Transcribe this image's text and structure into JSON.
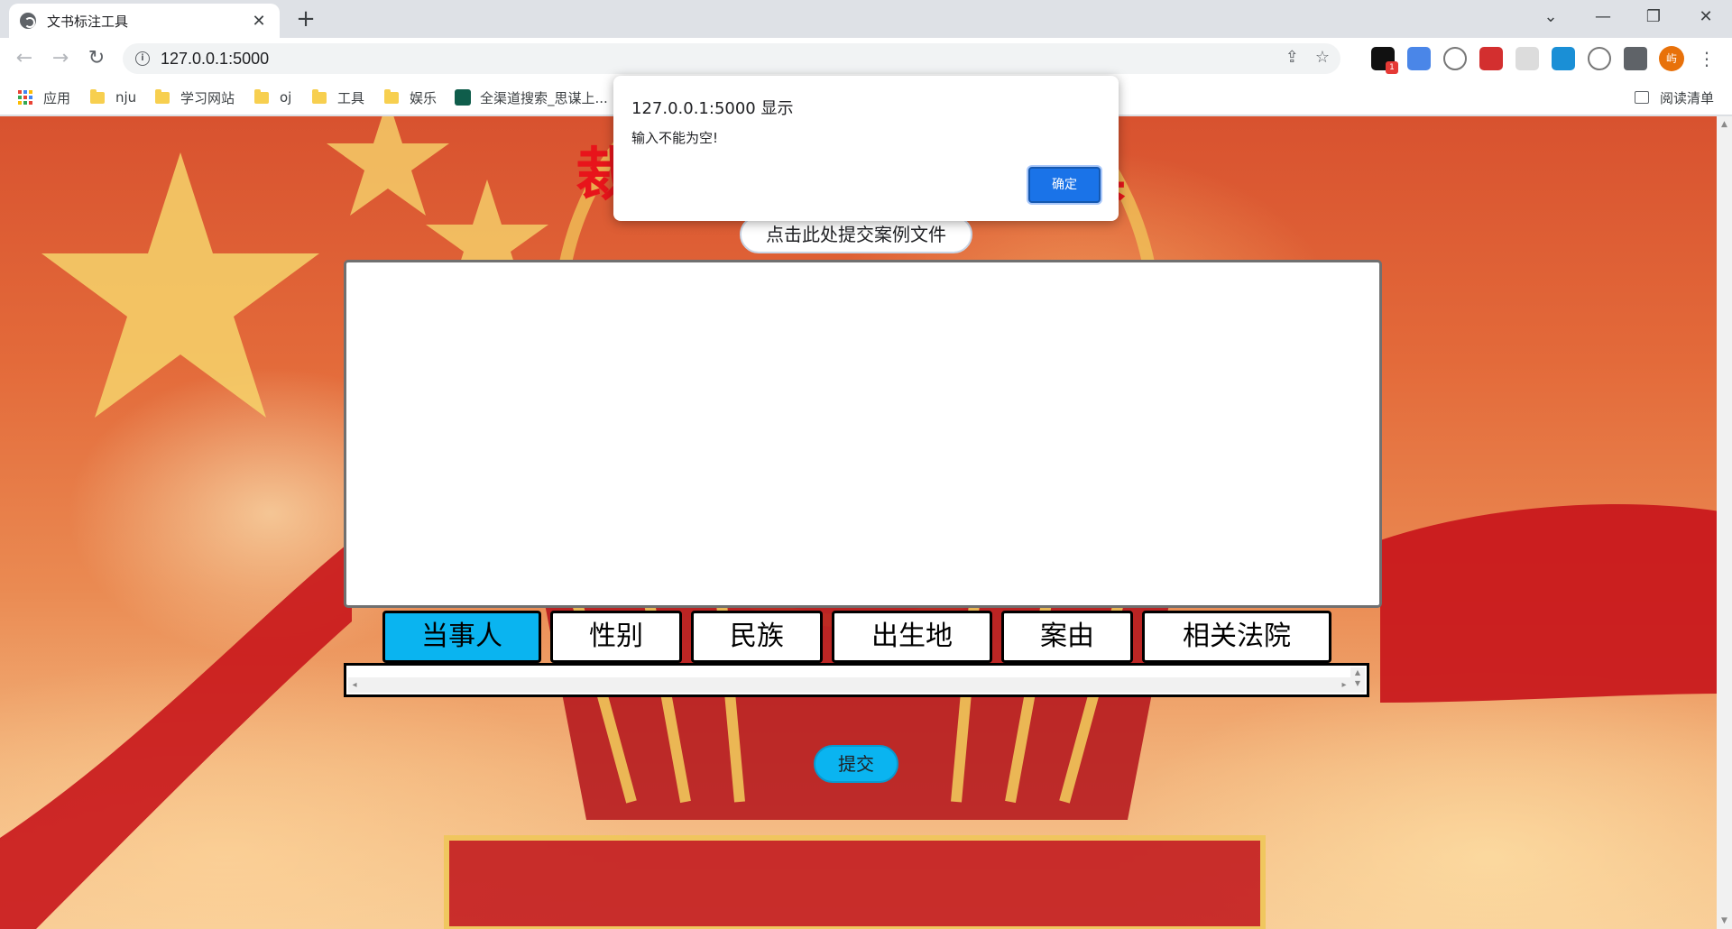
{
  "browser": {
    "tab_title": "文书标注工具",
    "tab_close": "✕",
    "new_tab": "+",
    "window_controls": {
      "tab_search": "⌄",
      "minimize": "—",
      "restore": "❐",
      "close": "✕"
    },
    "nav": {
      "back": "←",
      "forward": "→",
      "reload": "↻"
    },
    "url": "127.0.0.1:5000",
    "omnibox_actions": {
      "share": "⇪",
      "bookmark_star": "☆"
    },
    "extensions": [
      "notification-badge-icon",
      "translate-icon",
      "cloud-icon",
      "pdf-icon",
      "screen-share-icon",
      "folder-blue-icon",
      "cloud-icon-2",
      "puzzle-icon"
    ],
    "avatar_text": "屿",
    "menu": "⋮"
  },
  "bookmarks": {
    "items": [
      {
        "label": "应用",
        "icon": "apps-grid-icon"
      },
      {
        "label": "nju",
        "icon": "folder-icon"
      },
      {
        "label": "学习网站",
        "icon": "folder-icon"
      },
      {
        "label": "oj",
        "icon": "folder-icon"
      },
      {
        "label": "工具",
        "icon": "folder-icon"
      },
      {
        "label": "娱乐",
        "icon": "folder-icon"
      },
      {
        "label": "全渠道搜索_思谋上...",
        "icon": "site-icon"
      }
    ],
    "reading_list": "阅读清单"
  },
  "page": {
    "title": "裁判文书标注工具",
    "upload_button": "点击此处提交案例文件",
    "tags": [
      "当事人",
      "性别",
      "民族",
      "出生地",
      "案由",
      "相关法院"
    ],
    "active_tag": "当事人",
    "submit_button": "提交",
    "colors": {
      "title": "#e8141b",
      "active_tag": "#0ab4f0",
      "submit": "#0ab4f0"
    }
  },
  "dialog": {
    "title": "127.0.0.1:5000 显示",
    "message": "输入不能为空!",
    "ok_button": "确定"
  }
}
